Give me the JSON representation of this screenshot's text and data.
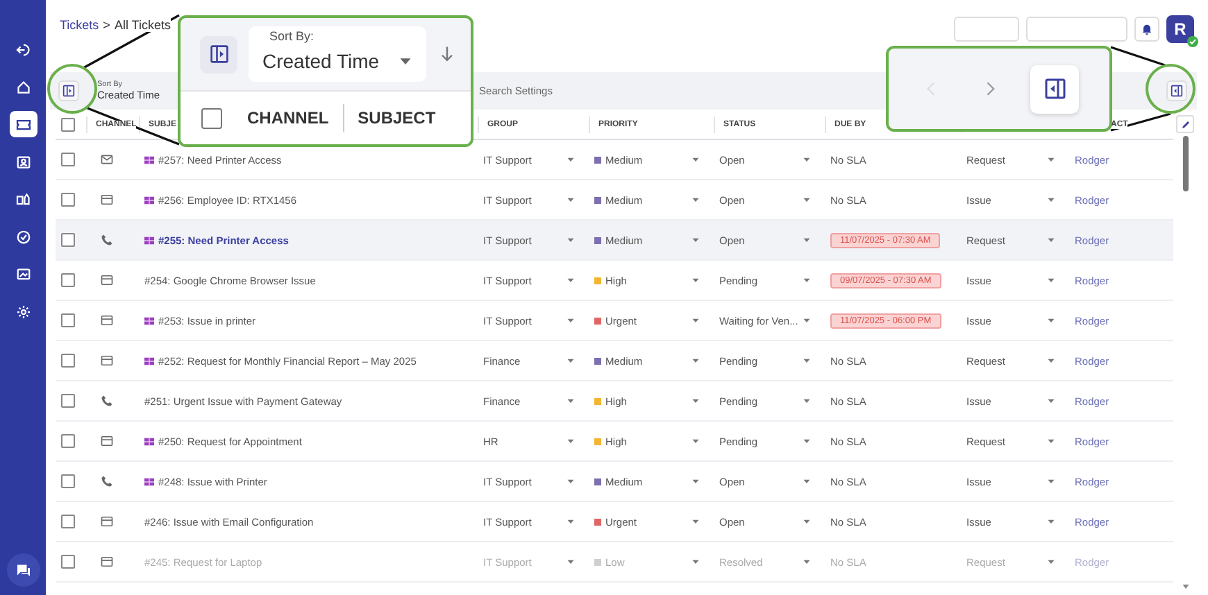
{
  "sidebar": {
    "items": [
      {
        "selected": false
      },
      {
        "selected": false
      },
      {
        "selected": true
      },
      {
        "selected": false
      },
      {
        "selected": false
      },
      {
        "selected": false
      },
      {
        "selected": false
      },
      {
        "selected": false
      }
    ]
  },
  "breadcrumb": {
    "parent": "Tickets",
    "separator": ">",
    "current": "All Tickets"
  },
  "user": {
    "initial": "R",
    "online": true
  },
  "toolbar": {
    "sort_label": "Sort By",
    "sort_value": "Created Time",
    "search_placeholder": "Search Settings"
  },
  "table": {
    "all_checked": false,
    "columns": [
      "CHANNEL",
      "SUBJE",
      "GROUP",
      "PRIORITY",
      "STATUS",
      "DUE BY",
      "ACT"
    ],
    "rows": [
      {
        "checked": false,
        "kind": "email",
        "merged": true,
        "subject": "#257: Need Printer Access",
        "group": "IT Support",
        "priority": "Medium",
        "color": "#7e6fae",
        "status": "Open",
        "due": "No SLA",
        "overdue": false,
        "type": "Request",
        "contact": "Rodger",
        "selected": false,
        "dimmed": false
      },
      {
        "checked": false,
        "kind": "portal",
        "merged": true,
        "subject": "#256: Employee ID: RTX1456",
        "group": "IT Support",
        "priority": "Medium",
        "color": "#7e6fae",
        "status": "Open",
        "due": "No SLA",
        "overdue": false,
        "type": "Issue",
        "contact": "Rodger",
        "selected": false,
        "dimmed": false
      },
      {
        "checked": false,
        "kind": "phone",
        "merged": true,
        "subject": "#255: Need Printer Access",
        "group": "IT Support",
        "priority": "Medium",
        "color": "#7e6fae",
        "status": "Open",
        "due": "11/07/2025 - 07:30 AM",
        "overdue": true,
        "type": "Request",
        "contact": "Rodger",
        "selected": true,
        "dimmed": false
      },
      {
        "checked": false,
        "kind": "portal",
        "merged": false,
        "subject": "#254: Google Chrome Browser Issue",
        "group": "IT Support",
        "priority": "High",
        "color": "#f2b632",
        "status": "Pending",
        "due": "09/07/2025 - 07:30 AM",
        "overdue": true,
        "type": "Issue",
        "contact": "Rodger",
        "selected": false,
        "dimmed": false
      },
      {
        "checked": false,
        "kind": "portal",
        "merged": true,
        "subject": "#253: Issue in printer",
        "group": "IT Support",
        "priority": "Urgent",
        "color": "#e06666",
        "status": "Waiting for Ven...",
        "due": "11/07/2025 - 06:00 PM",
        "overdue": true,
        "type": "Issue",
        "contact": "Rodger",
        "selected": false,
        "dimmed": false
      },
      {
        "checked": false,
        "kind": "portal",
        "merged": true,
        "subject": "#252: Request for Monthly Financial Report – May 2025",
        "group": "Finance",
        "priority": "Medium",
        "color": "#7e6fae",
        "status": "Pending",
        "due": "No SLA",
        "overdue": false,
        "type": "Request",
        "contact": "Rodger",
        "selected": false,
        "dimmed": false
      },
      {
        "checked": false,
        "kind": "phone",
        "merged": false,
        "subject": "#251: Urgent Issue with Payment Gateway",
        "group": "Finance",
        "priority": "High",
        "color": "#f2b632",
        "status": "Pending",
        "due": "No SLA",
        "overdue": false,
        "type": "Issue",
        "contact": "Rodger",
        "selected": false,
        "dimmed": false
      },
      {
        "checked": false,
        "kind": "portal",
        "merged": true,
        "subject": "#250: Request for Appointment",
        "group": "HR",
        "priority": "High",
        "color": "#f2b632",
        "status": "Pending",
        "due": "No SLA",
        "overdue": false,
        "type": "Request",
        "contact": "Rodger",
        "selected": false,
        "dimmed": false
      },
      {
        "checked": false,
        "kind": "phone",
        "merged": true,
        "subject": "#248: Issue with Printer",
        "group": "IT Support",
        "priority": "Medium",
        "color": "#7e6fae",
        "status": "Open",
        "due": "No SLA",
        "overdue": false,
        "type": "Issue",
        "contact": "Rodger",
        "selected": false,
        "dimmed": false
      },
      {
        "checked": false,
        "kind": "portal",
        "merged": false,
        "subject": "#246: Issue with Email Configuration",
        "group": "IT Support",
        "priority": "Urgent",
        "color": "#e06666",
        "status": "Open",
        "due": "No SLA",
        "overdue": false,
        "type": "Issue",
        "contact": "Rodger",
        "selected": false,
        "dimmed": false
      },
      {
        "checked": false,
        "kind": "portal",
        "merged": false,
        "subject": "#245: Request for Laptop",
        "group": "IT Support",
        "priority": "Low",
        "color": "#cfcfcf",
        "status": "Resolved",
        "due": "No SLA",
        "overdue": false,
        "type": "Request",
        "contact": "Rodger",
        "selected": false,
        "dimmed": true
      }
    ]
  },
  "callouts": {
    "sort": {
      "label": "Sort By:",
      "value": "Created Time",
      "checked": false,
      "columns": [
        "CHANNEL",
        "SUBJECT"
      ]
    },
    "pager": {
      "prev_disabled": true,
      "next_disabled": false
    }
  }
}
